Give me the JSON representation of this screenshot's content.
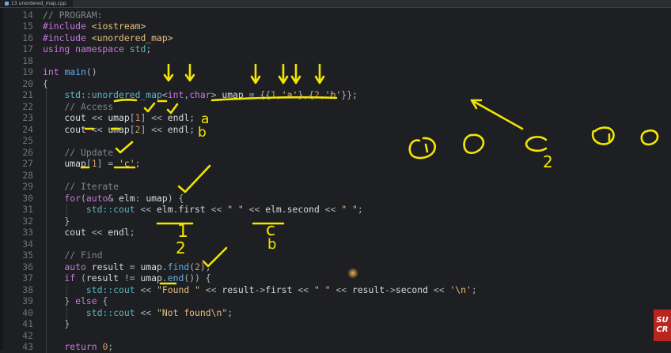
{
  "tab": {
    "label": "13 unordered_map.cpp",
    "icon": "cpp-file-icon"
  },
  "badge": {
    "line1": "SU",
    "line2": "CR"
  },
  "code_lines": [
    {
      "n": "14",
      "tokens": [
        [
          "c-cm",
          "// PROGRAM:"
        ]
      ]
    },
    {
      "n": "15",
      "tokens": [
        [
          "c-pp",
          "#include "
        ],
        [
          "c-inc",
          "<iostream>"
        ]
      ]
    },
    {
      "n": "16",
      "tokens": [
        [
          "c-pp",
          "#include "
        ],
        [
          "c-inc",
          "<unordered_map>"
        ]
      ]
    },
    {
      "n": "17",
      "tokens": [
        [
          "c-kw",
          "using namespace "
        ],
        [
          "c-ty",
          "std"
        ],
        [
          "c-op",
          ";"
        ]
      ]
    },
    {
      "n": "18",
      "tokens": []
    },
    {
      "n": "19",
      "tokens": [
        [
          "c-kw",
          "int "
        ],
        [
          "c-fn",
          "main"
        ],
        [
          "c-op",
          "()"
        ]
      ]
    },
    {
      "n": "20",
      "tokens": [
        [
          "c-op",
          "{"
        ]
      ]
    },
    {
      "n": "21",
      "tokens": [
        [
          "c-va",
          "    "
        ],
        [
          "c-ty",
          "std::unordered_map"
        ],
        [
          "c-op",
          "<"
        ],
        [
          "c-kw",
          "int"
        ],
        [
          "c-op",
          ","
        ],
        [
          "c-kw",
          "char"
        ],
        [
          "c-op",
          "> "
        ],
        [
          "c-va",
          "umap"
        ],
        [
          "c-op",
          " = {{"
        ],
        [
          "c-nu",
          "1"
        ],
        [
          "c-op",
          ","
        ],
        [
          "c-st",
          "'a'"
        ],
        [
          "c-op",
          "},{"
        ],
        [
          "c-nu",
          "2"
        ],
        [
          "c-op",
          ","
        ],
        [
          "c-st",
          "'b'"
        ],
        [
          "c-op",
          "}};"
        ]
      ]
    },
    {
      "n": "22",
      "tokens": [
        [
          "c-cm",
          "    // Access"
        ]
      ]
    },
    {
      "n": "23",
      "tokens": [
        [
          "c-va",
          "    cout "
        ],
        [
          "c-op",
          "<< "
        ],
        [
          "c-va",
          "umap"
        ],
        [
          "c-op",
          "["
        ],
        [
          "c-nu",
          "1"
        ],
        [
          "c-op",
          "] << "
        ],
        [
          "c-va",
          "endl"
        ],
        [
          "c-op",
          ";"
        ]
      ]
    },
    {
      "n": "24",
      "tokens": [
        [
          "c-va",
          "    cout "
        ],
        [
          "c-op",
          "<< "
        ],
        [
          "c-va",
          "umap"
        ],
        [
          "c-op",
          "["
        ],
        [
          "c-nu",
          "2"
        ],
        [
          "c-op",
          "] << "
        ],
        [
          "c-va",
          "endl"
        ],
        [
          "c-op",
          ";"
        ]
      ]
    },
    {
      "n": "25",
      "tokens": []
    },
    {
      "n": "26",
      "tokens": [
        [
          "c-cm",
          "    // Update"
        ]
      ]
    },
    {
      "n": "27",
      "tokens": [
        [
          "c-va",
          "    umap"
        ],
        [
          "c-op",
          "["
        ],
        [
          "c-nu",
          "1"
        ],
        [
          "c-op",
          "] = "
        ],
        [
          "c-st",
          "'c'"
        ],
        [
          "c-op",
          ";"
        ]
      ]
    },
    {
      "n": "28",
      "tokens": []
    },
    {
      "n": "29",
      "tokens": [
        [
          "c-cm",
          "    // Iterate"
        ]
      ]
    },
    {
      "n": "30",
      "tokens": [
        [
          "c-kw",
          "    for"
        ],
        [
          "c-op",
          "("
        ],
        [
          "c-kw",
          "auto"
        ],
        [
          "c-op",
          "& "
        ],
        [
          "c-va",
          "elm"
        ],
        [
          "c-op",
          ": "
        ],
        [
          "c-va",
          "umap"
        ],
        [
          "c-op",
          ") {"
        ]
      ]
    },
    {
      "n": "31",
      "tokens": [
        [
          "c-ty",
          "        std::cout "
        ],
        [
          "c-op",
          "<< "
        ],
        [
          "c-va",
          "elm"
        ],
        [
          "c-op",
          "."
        ],
        [
          "c-va",
          "first"
        ],
        [
          "c-op",
          " << "
        ],
        [
          "c-st",
          "\" \""
        ],
        [
          "c-op",
          " << "
        ],
        [
          "c-va",
          "elm"
        ],
        [
          "c-op",
          "."
        ],
        [
          "c-va",
          "second"
        ],
        [
          "c-op",
          " << "
        ],
        [
          "c-st",
          "\" \""
        ],
        [
          "c-op",
          ";"
        ]
      ]
    },
    {
      "n": "32",
      "tokens": [
        [
          "c-op",
          "    }"
        ]
      ]
    },
    {
      "n": "33",
      "tokens": [
        [
          "c-va",
          "    cout "
        ],
        [
          "c-op",
          "<< "
        ],
        [
          "c-va",
          "endl"
        ],
        [
          "c-op",
          ";"
        ]
      ]
    },
    {
      "n": "34",
      "tokens": []
    },
    {
      "n": "35",
      "tokens": [
        [
          "c-cm",
          "    // Find"
        ]
      ]
    },
    {
      "n": "36",
      "tokens": [
        [
          "c-kw",
          "    auto "
        ],
        [
          "c-va",
          "result"
        ],
        [
          "c-op",
          " = "
        ],
        [
          "c-va",
          "umap"
        ],
        [
          "c-op",
          "."
        ],
        [
          "c-fn",
          "find"
        ],
        [
          "c-op",
          "("
        ],
        [
          "c-nu",
          "2"
        ],
        [
          "c-op",
          ");"
        ]
      ]
    },
    {
      "n": "37",
      "tokens": [
        [
          "c-kw",
          "    if "
        ],
        [
          "c-op",
          "("
        ],
        [
          "c-va",
          "result"
        ],
        [
          "c-op",
          " != "
        ],
        [
          "c-va",
          "umap"
        ],
        [
          "c-op",
          "."
        ],
        [
          "c-fn",
          "end"
        ],
        [
          "c-op",
          "()) {"
        ]
      ]
    },
    {
      "n": "38",
      "tokens": [
        [
          "c-ty",
          "        std::cout "
        ],
        [
          "c-op",
          "<< "
        ],
        [
          "c-st",
          "\"Found \""
        ],
        [
          "c-op",
          " << "
        ],
        [
          "c-va",
          "result"
        ],
        [
          "c-op",
          "->"
        ],
        [
          "c-va",
          "first"
        ],
        [
          "c-op",
          " << "
        ],
        [
          "c-st",
          "\" \""
        ],
        [
          "c-op",
          " << "
        ],
        [
          "c-va",
          "result"
        ],
        [
          "c-op",
          "->"
        ],
        [
          "c-va",
          "second"
        ],
        [
          "c-op",
          " << "
        ],
        [
          "c-st",
          "'\\n'"
        ],
        [
          "c-op",
          ";"
        ]
      ]
    },
    {
      "n": "39",
      "tokens": [
        [
          "c-op",
          "    } "
        ],
        [
          "c-kw",
          "else"
        ],
        [
          "c-op",
          " {"
        ]
      ]
    },
    {
      "n": "40",
      "tokens": [
        [
          "c-ty",
          "        std::cout "
        ],
        [
          "c-op",
          "<< "
        ],
        [
          "c-st",
          "\"Not found\\n\""
        ],
        [
          "c-op",
          ";"
        ]
      ]
    },
    {
      "n": "41",
      "tokens": [
        [
          "c-op",
          "    }"
        ]
      ]
    },
    {
      "n": "42",
      "tokens": []
    },
    {
      "n": "43",
      "tokens": [
        [
          "c-kw",
          "    return "
        ],
        [
          "c-nu",
          "0"
        ],
        [
          "c-op",
          ";"
        ]
      ]
    }
  ],
  "annotations": {
    "access_letters": [
      "a",
      "b"
    ],
    "iterate_first": "1",
    "iterate_first_2": "2",
    "iterate_second": "c",
    "iterate_second_2": "b",
    "bucket_label": "2",
    "ink_color": "#f2e600"
  },
  "colors": {
    "background": "#1e1f22",
    "comment": "#7f848e",
    "keyword": "#c678dd",
    "type": "#56b6c2",
    "function": "#61afef",
    "string": "#e5c07b",
    "number": "#d19a66"
  }
}
